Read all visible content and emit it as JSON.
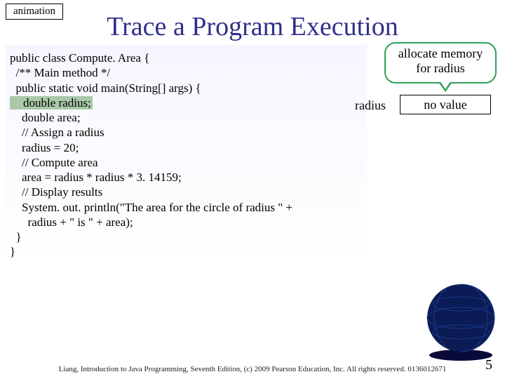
{
  "animation_label": "animation",
  "title": "Trace a Program Execution",
  "callout": {
    "line1": "allocate memory",
    "line2": "for radius"
  },
  "memory": {
    "label": "radius",
    "value": "no value"
  },
  "code": {
    "l1": "public class Compute. Area {",
    "l2": "  /** Main method */",
    "l3": "  public static void main(String[] args) {",
    "l4_hl": "    double radius;",
    "l5": "    double area;",
    "l6": "",
    "l7": "    // Assign a radius",
    "l8": "    radius = 20;",
    "l9": "",
    "l10": "    // Compute area",
    "l11": "    area = radius * radius * 3. 14159;",
    "l12": "",
    "l13": "    // Display results",
    "l14": "    System. out. println(\"The area for the circle of radius \" +",
    "l15": "      radius + \" is \" + area);",
    "l16": "  }",
    "l17": "}"
  },
  "footer": "Liang, Introduction to Java Programming, Seventh Edition, (c) 2009 Pearson Education, Inc. All rights reserved. 0136012671",
  "page_number": "5"
}
